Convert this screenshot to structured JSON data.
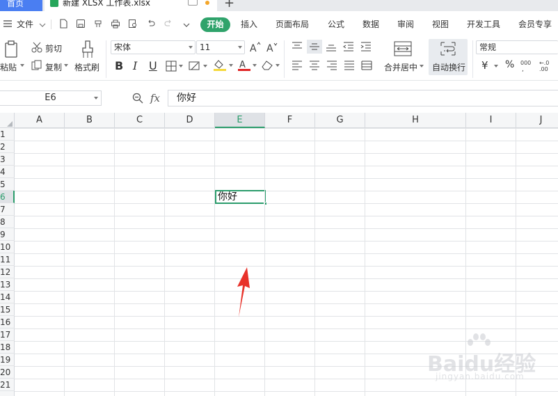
{
  "tabbar": {
    "home_label": "首页",
    "doc_title": "新建 XLSX 工作表.xlsx",
    "add_tab": "+"
  },
  "menu": {
    "file": "文件",
    "items": [
      "开始",
      "插入",
      "页面布局",
      "公式",
      "数据",
      "审阅",
      "视图",
      "开发工具",
      "会员专享"
    ]
  },
  "ribbon": {
    "paste": "粘贴",
    "cut": "剪切",
    "copy": "复制",
    "format_painter": "格式刷",
    "font_name": "宋体",
    "font_size": "11",
    "bold": "B",
    "italic": "I",
    "underline": "U",
    "merge_center": "合并居中",
    "wrap_text": "自动换行",
    "number_format": "常规",
    "currency": "¥",
    "percent": "%"
  },
  "formula_bar": {
    "name_box": "E6",
    "fx": "fx",
    "content": "你好"
  },
  "sheet": {
    "columns": [
      "A",
      "B",
      "C",
      "D",
      "E",
      "F",
      "G",
      "H",
      "I",
      "J"
    ],
    "rows": [
      "1",
      "2",
      "3",
      "4",
      "5",
      "6",
      "7",
      "8",
      "9",
      "10",
      "11",
      "12",
      "13",
      "14",
      "15",
      "16",
      "17",
      "18",
      "19",
      "20",
      "21"
    ],
    "active_cell": "E6",
    "active_value": "你好"
  },
  "colors": {
    "accent": "#2fa36b",
    "home_tab": "#4a7ef2",
    "arrow": "#e8322a"
  },
  "watermark": {
    "text": "Baidu经验",
    "url": "jingyan.baidu.com"
  }
}
